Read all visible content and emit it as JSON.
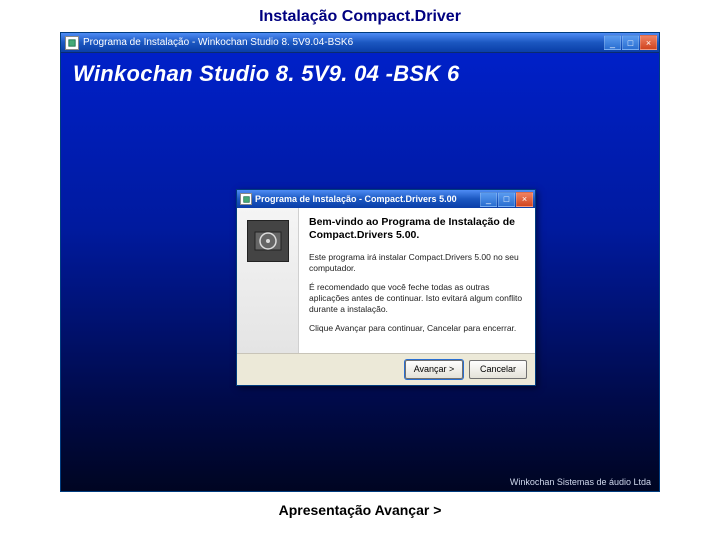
{
  "page": {
    "heading": "Instalação Compact.Driver",
    "footer_link": "Apresentação Avançar >"
  },
  "outer_window": {
    "title": "Programa de Instalação - Winkochan Studio 8. 5V9.04-BSK6",
    "product_title": "Winkochan Studio 8. 5V9. 04 -BSK 6",
    "footer_copy": "Winkochan Sistemas de áudio Ltda"
  },
  "inner_window": {
    "title": "Programa de Instalação - Compact.Drivers 5.00",
    "heading": "Bem-vindo ao Programa de Instalação de Compact.Drivers 5.00.",
    "paragraphs": {
      "p1": "Este programa irá instalar Compact.Drivers 5.00 no seu computador.",
      "p2": "É recomendado que você feche todas as outras aplicações antes de continuar. Isto evitará algum conflito durante a instalação.",
      "p3": "Clique Avançar para continuar, Cancelar para encerrar."
    },
    "buttons": {
      "next": "Avançar >",
      "cancel": "Cancelar"
    }
  }
}
